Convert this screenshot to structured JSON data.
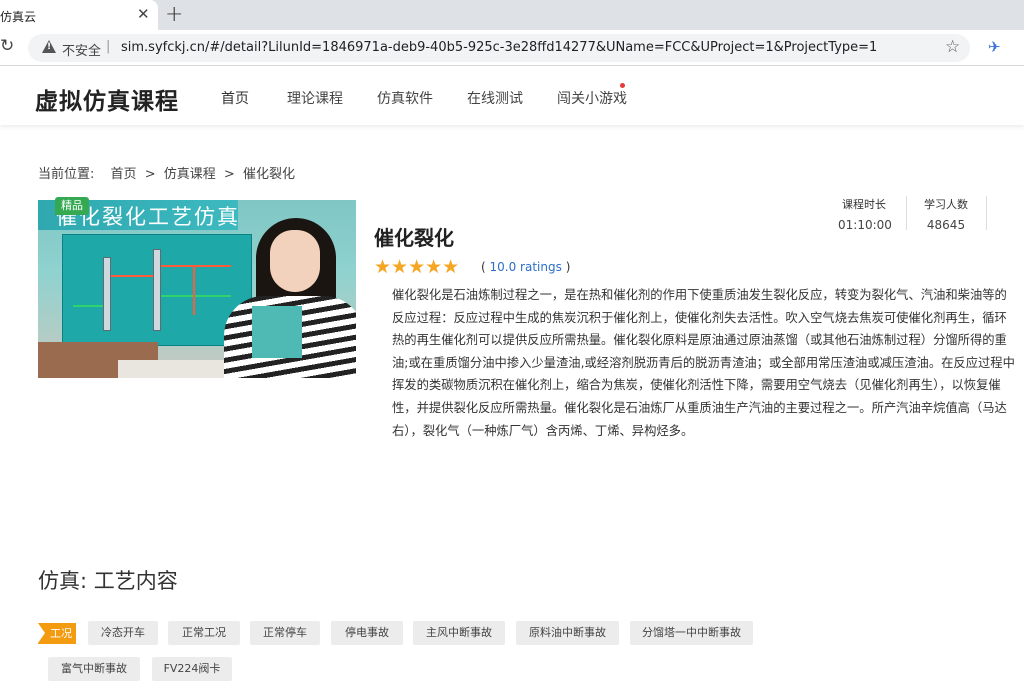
{
  "browser": {
    "tab_title": "仿真云",
    "close_glyph": "✕",
    "newtab_glyph": "+",
    "reload_glyph": "↻",
    "insecure_label": "不安全",
    "separator": "|",
    "url": "sim.syfckj.cn/#/detail?LilunId=1846971a-deb9-40b5-925c-3e28ffd14277&UName=FCC&UProject=1&ProjectType=1",
    "favorite_glyph": "☆",
    "extension_glyph": "✈"
  },
  "site": {
    "logo": "虚拟仿真课程",
    "nav": [
      "首页",
      "理论课程",
      "仿真软件",
      "在线测试",
      "闯关小游戏"
    ]
  },
  "breadcrumb": {
    "label": "当前位置:",
    "items": [
      "首页",
      ">",
      "仿真课程",
      ">",
      "催化裂化"
    ]
  },
  "course": {
    "image_title": "催化裂化工艺仿真",
    "badge": "精品",
    "title": "催化裂化",
    "stars": "★★★★★",
    "rating_open": "(",
    "rating_value": "10.0 ratings",
    "rating_close": ")",
    "duration_label": "课程时长",
    "duration_value": "01:10:00",
    "learners_label": "学习人数",
    "learners_value": "48645",
    "description_lines": [
      "催化裂化是石油炼制过程之一，是在热和催化剂的作用下使重质油发生裂化反应，转变为裂化气、汽油和柴油等的",
      "反应过程：反应过程中生成的焦炭沉积于催化剂上，使催化剂失去活性。吹入空气烧去焦炭可使催化剂再生，循环",
      "热的再生催化剂可以提供反应所需热量。催化裂化原料是原油通过原油蒸馏（或其他石油炼制过程）分馏所得的重",
      "油;或在重质馏分油中掺入少量渣油,或经溶剂脱沥青后的脱沥青渣油；或全部用常压渣油或减压渣油。在反应过程中",
      "挥发的类碳物质沉积在催化剂上，缩合为焦炭，使催化剂活性下降，需要用空气烧去（见催化剂再生），以恢复催",
      "性，并提供裂化反应所需热量。催化裂化是石油炼厂从重质油生产汽油的主要过程之一。所产汽油辛烷值高（马达",
      "右），裂化气（一种炼厂气）含丙烯、丁烯、异构烃多。"
    ]
  },
  "section": {
    "title": "仿真: 工艺内容",
    "tag_label": "工况",
    "chips": [
      "冷态开车",
      "正常工况",
      "正常停车",
      "停电事故",
      "主风中断事故",
      "原料油中断事故",
      "分馏塔一中中断事故",
      "富气中断事故",
      "FV224阀卡"
    ]
  },
  "colors": {
    "star": "#f5a623",
    "tag": "#f39c12",
    "badge": "#35a852",
    "rating_link": "#2b6fc7"
  }
}
